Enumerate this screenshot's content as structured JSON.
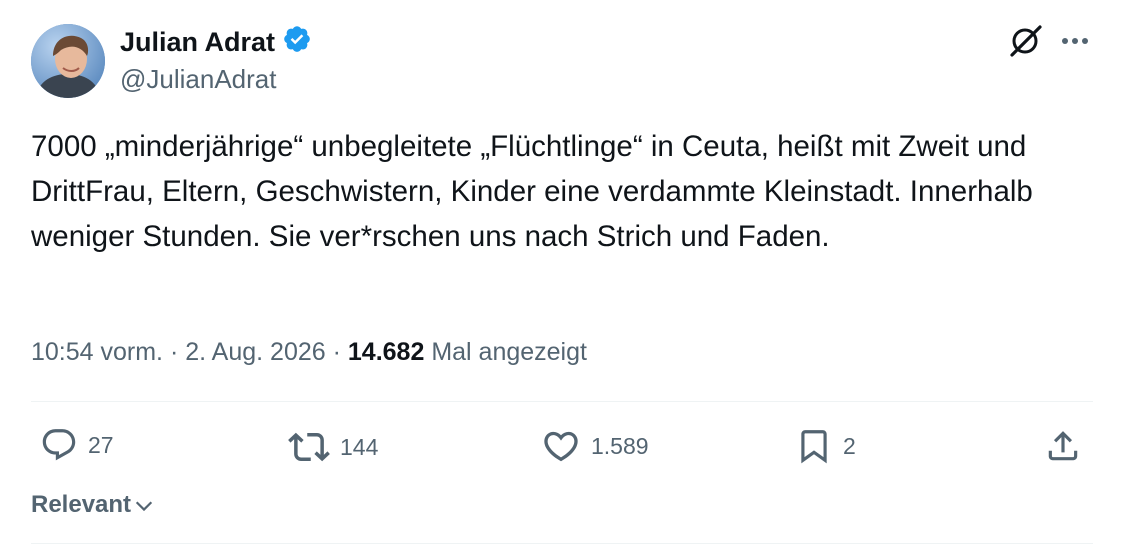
{
  "author": {
    "name": "Julian Adrat",
    "handle": "@JulianAdrat",
    "verified": true,
    "verified_color": "#1d9bf0",
    "avatar_icon": "profile-photo"
  },
  "tweet": {
    "text": "7000 „minderjährige“ unbegleitete „Flüchtlinge“ in Ceuta, heißt mit Zweit und DrittFrau, Eltern, Geschwistern, Kinder eine verdammte Kleinstadt. Innerhalb weniger Stunden. Sie ver*rschen uns nach Strich und Faden."
  },
  "meta": {
    "time": "10:54 vorm.",
    "separator": "·",
    "date": "2. Aug. 2026",
    "views_count": "14.682",
    "views_label": "Mal angezeigt"
  },
  "header_icons": {
    "grok": "grok-icon",
    "more": "more-icon"
  },
  "actions": {
    "replies": "27",
    "reposts": "144",
    "likes": "1.589",
    "bookmarks": "2",
    "share_icon": "share-icon"
  },
  "sort": {
    "label": "Relevant"
  },
  "colors": {
    "text": "#0f1419",
    "secondary": "#536471",
    "divider": "#eff3f4"
  }
}
